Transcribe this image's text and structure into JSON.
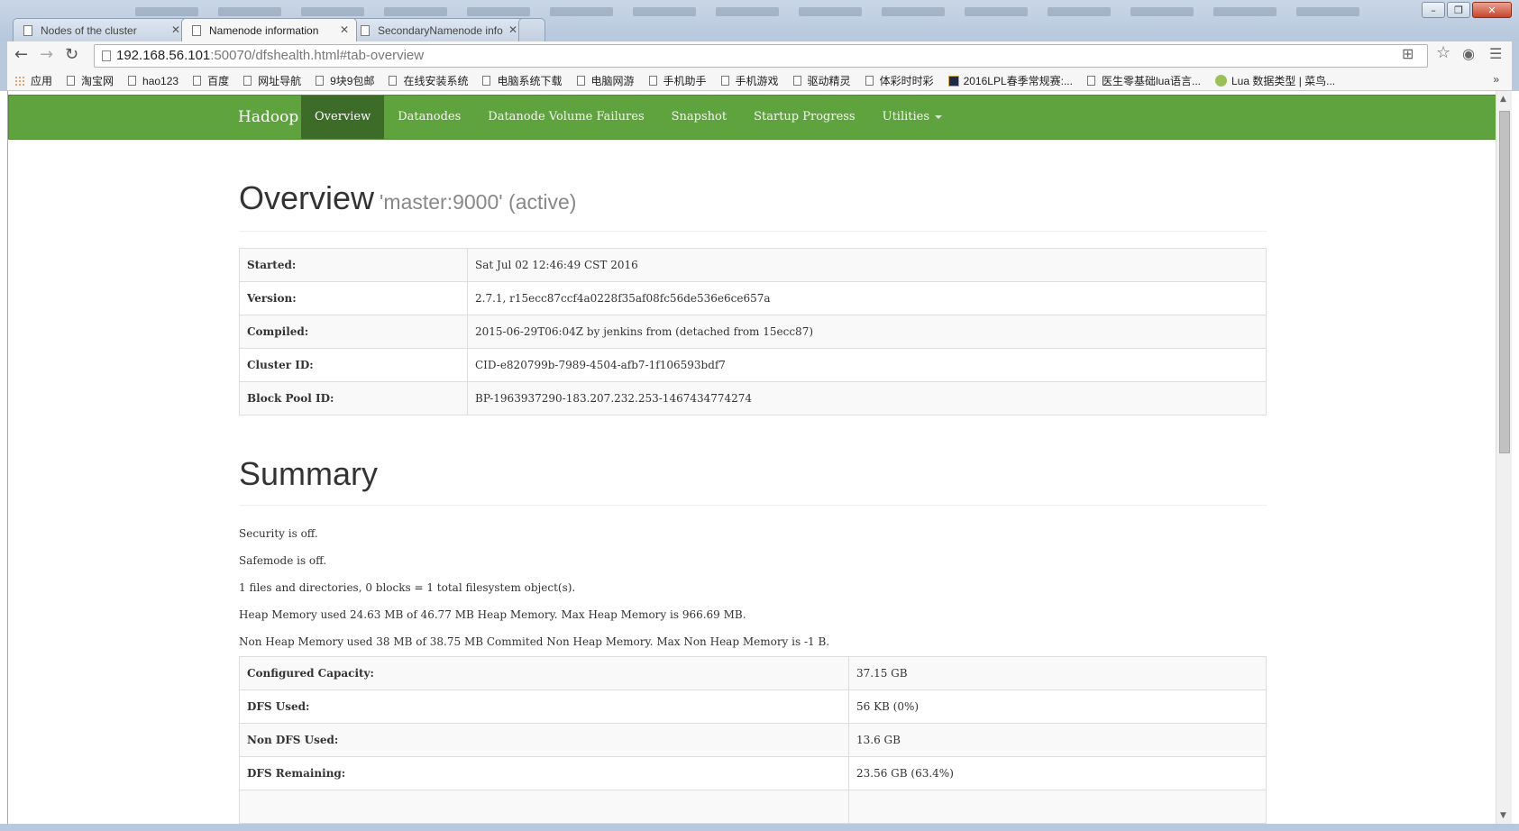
{
  "browser": {
    "tabs": [
      {
        "title": "Nodes of the cluster",
        "close": "✕"
      },
      {
        "title": "Namenode information",
        "close": "✕"
      },
      {
        "title": "SecondaryNamenode info",
        "close": "✕"
      }
    ],
    "address": {
      "host": "192.168.56.101",
      "path": ":50070/dfshealth.html#tab-overview"
    },
    "nav_icons": {
      "back": "←",
      "forward": "→",
      "reload": "↻"
    },
    "right_icons": {
      "translate": "⊞",
      "star": "☆",
      "eye": "◉",
      "menu": "☰"
    },
    "window_controls": {
      "minimize": "–",
      "maximize": "❐",
      "close": "✕"
    },
    "bookmarks": [
      "应用",
      "淘宝网",
      "hao123",
      "百度",
      "网址导航",
      "9块9包邮",
      "在线安装系统",
      "电脑系统下载",
      "电脑网游",
      "手机助手",
      "手机游戏",
      "驱动精灵",
      "体彩时时彩",
      "2016LPL春季常规赛:...",
      "医生零基础lua语言...",
      "Lua 数据类型 | 菜鸟..."
    ],
    "bookmarks_more": "»"
  },
  "navbar": {
    "brand": "Hadoop",
    "items": [
      "Overview",
      "Datanodes",
      "Datanode Volume Failures",
      "Snapshot",
      "Startup Progress",
      "Utilities"
    ],
    "active": "Overview"
  },
  "overview": {
    "title": "Overview",
    "subtitle": "'master:9000' (active)",
    "rows": [
      {
        "label": "Started:",
        "value": "Sat Jul 02 12:46:49 CST 2016"
      },
      {
        "label": "Version:",
        "value": "2.7.1, r15ecc87ccf4a0228f35af08fc56de536e6ce657a"
      },
      {
        "label": "Compiled:",
        "value": "2015-06-29T06:04Z by jenkins from (detached from 15ecc87)"
      },
      {
        "label": "Cluster ID:",
        "value": "CID-e820799b-7989-4504-afb7-1f106593bdf7"
      },
      {
        "label": "Block Pool ID:",
        "value": "BP-1963937290-183.207.232.253-1467434774274"
      }
    ]
  },
  "summary": {
    "title": "Summary",
    "lines": [
      "Security is off.",
      "Safemode is off.",
      "1 files and directories, 0 blocks = 1 total filesystem object(s).",
      "Heap Memory used 24.63 MB of 46.77 MB Heap Memory. Max Heap Memory is 966.69 MB.",
      "Non Heap Memory used 38 MB of 38.75 MB Commited Non Heap Memory. Max Non Heap Memory is -1 B."
    ],
    "rows": [
      {
        "label": "Configured Capacity:",
        "value": "37.15 GB"
      },
      {
        "label": "DFS Used:",
        "value": "56 KB (0%)"
      },
      {
        "label": "Non DFS Used:",
        "value": "13.6 GB"
      },
      {
        "label": "DFS Remaining:",
        "value": "23.56 GB (63.4%)"
      },
      {
        "label": "",
        "value": ""
      }
    ]
  },
  "colors": {
    "navbar": "#5fa33e",
    "navbar_active": "#3d6b28"
  }
}
